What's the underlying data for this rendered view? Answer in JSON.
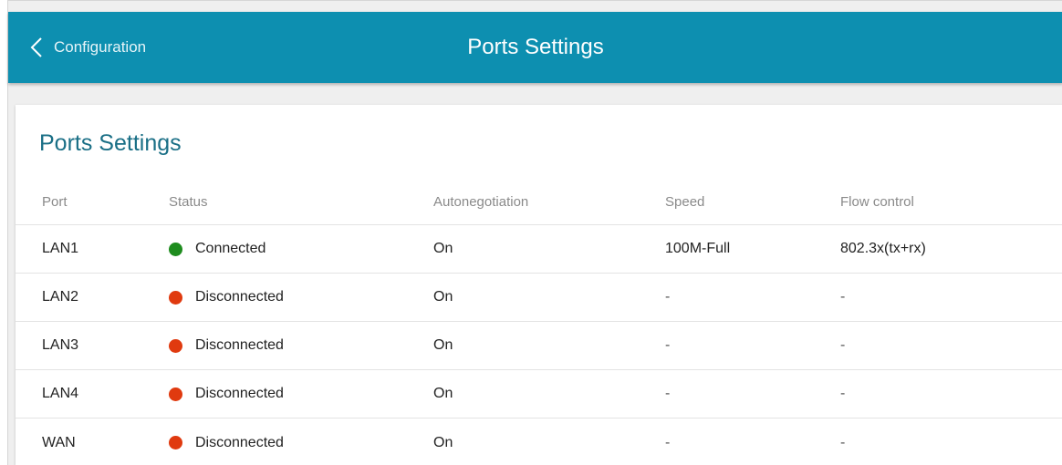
{
  "header": {
    "back_label": "Configuration",
    "title": "Ports Settings",
    "color": "#0d8fb0"
  },
  "card": {
    "title": "Ports Settings"
  },
  "table": {
    "columns": [
      "Port",
      "Status",
      "Autonegotiation",
      "Speed",
      "Flow control"
    ],
    "rows": [
      {
        "port": "LAN1",
        "status": "Connected",
        "status_color": "#1e8c1e",
        "autonegotiation": "On",
        "speed": "100M-Full",
        "flow_control": "802.3x(tx+rx)"
      },
      {
        "port": "LAN2",
        "status": "Disconnected",
        "status_color": "#e03a0f",
        "autonegotiation": "On",
        "speed": "-",
        "flow_control": "-"
      },
      {
        "port": "LAN3",
        "status": "Disconnected",
        "status_color": "#e03a0f",
        "autonegotiation": "On",
        "speed": "-",
        "flow_control": "-"
      },
      {
        "port": "LAN4",
        "status": "Disconnected",
        "status_color": "#e03a0f",
        "autonegotiation": "On",
        "speed": "-",
        "flow_control": "-"
      },
      {
        "port": "WAN",
        "status": "Disconnected",
        "status_color": "#e03a0f",
        "autonegotiation": "On",
        "speed": "-",
        "flow_control": "-"
      }
    ]
  }
}
